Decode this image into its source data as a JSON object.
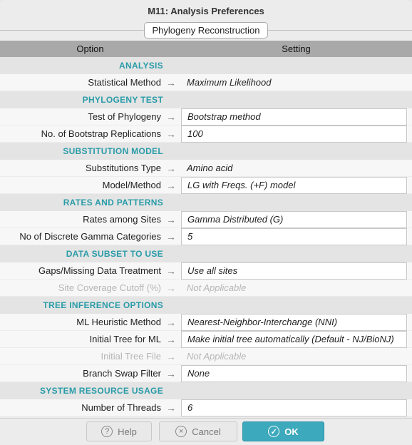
{
  "window": {
    "title": "M11: Analysis Preferences",
    "tab": "Phylogeny Reconstruction"
  },
  "table": {
    "col_option": "Option",
    "col_setting": "Setting"
  },
  "rows": [
    {
      "type": "section",
      "label": "ANALYSIS"
    },
    {
      "type": "item",
      "label": "Statistical Method",
      "value": "Maximum Likelihood",
      "box": false,
      "disabled": false
    },
    {
      "type": "section",
      "label": "PHYLOGENY TEST"
    },
    {
      "type": "item",
      "label": "Test of Phylogeny",
      "value": "Bootstrap method",
      "box": true,
      "disabled": false
    },
    {
      "type": "item",
      "label": "No. of Bootstrap Replications",
      "value": "100",
      "box": true,
      "disabled": false
    },
    {
      "type": "section",
      "label": "SUBSTITUTION MODEL"
    },
    {
      "type": "item",
      "label": "Substitutions Type",
      "value": "Amino acid",
      "box": false,
      "disabled": false
    },
    {
      "type": "item",
      "label": "Model/Method",
      "value": "LG with Freqs. (+F) model",
      "box": true,
      "disabled": false
    },
    {
      "type": "section",
      "label": "RATES AND PATTERNS"
    },
    {
      "type": "item",
      "label": "Rates among Sites",
      "value": "Gamma Distributed (G)",
      "box": true,
      "disabled": false
    },
    {
      "type": "item",
      "label": "No of Discrete Gamma Categories",
      "value": "5",
      "box": true,
      "disabled": false
    },
    {
      "type": "section",
      "label": "DATA SUBSET TO USE"
    },
    {
      "type": "item",
      "label": "Gaps/Missing Data Treatment",
      "value": "Use all sites",
      "box": true,
      "disabled": false
    },
    {
      "type": "item",
      "label": "Site Coverage Cutoff (%)",
      "value": "Not Applicable",
      "box": false,
      "disabled": true
    },
    {
      "type": "section",
      "label": "TREE INFERENCE OPTIONS"
    },
    {
      "type": "item",
      "label": "ML Heuristic Method",
      "value": "Nearest-Neighbor-Interchange (NNI)",
      "box": true,
      "disabled": false
    },
    {
      "type": "item",
      "label": "Initial Tree for ML",
      "value": "Make initial tree automatically (Default - NJ/BioNJ)",
      "box": true,
      "disabled": false
    },
    {
      "type": "item",
      "label": "Initial Tree File",
      "value": "Not Applicable",
      "box": false,
      "disabled": true
    },
    {
      "type": "item",
      "label": "Branch Swap Filter",
      "value": "None",
      "box": true,
      "disabled": false
    },
    {
      "type": "section",
      "label": "SYSTEM RESOURCE USAGE"
    },
    {
      "type": "item",
      "label": "Number of Threads",
      "value": "6",
      "box": true,
      "disabled": false
    }
  ],
  "buttons": {
    "help": "Help",
    "cancel": "Cancel",
    "ok": "OK"
  },
  "icons": {
    "arrow": "→",
    "help": "?",
    "cancel": "×",
    "ok": "✓"
  }
}
